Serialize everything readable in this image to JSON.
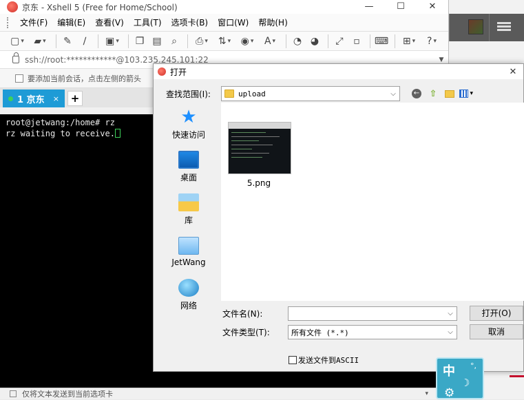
{
  "window": {
    "title": "京东 - Xshell 5 (Free for Home/School)",
    "controls": {
      "minimize": "—",
      "maximize": "☐",
      "close": "✕"
    }
  },
  "menu": [
    "文件(F)",
    "编辑(E)",
    "查看(V)",
    "工具(T)",
    "选项卡(B)",
    "窗口(W)",
    "帮助(H)"
  ],
  "address": {
    "value": "ssh://root:************@103.235.245.101:22"
  },
  "hint": {
    "text": "要添加当前会话，点击左侧的箭头"
  },
  "tabs": [
    {
      "label": "1 京东",
      "close": "×",
      "active": true
    }
  ],
  "tab_add": "+",
  "terminal": {
    "lines": [
      "root@jetwang:/home# rz",
      "rz waiting to receive."
    ]
  },
  "sendbar": {
    "text": "仅将文本发送到当前选项卡"
  },
  "dialog": {
    "title": "打开",
    "close": "✕",
    "look_in_label": "查找范围(I):",
    "look_in_value": "upload",
    "places": [
      {
        "label": "快速访问",
        "icon": "star-icon"
      },
      {
        "label": "桌面",
        "icon": "desktop-icon"
      },
      {
        "label": "库",
        "icon": "library-icon"
      },
      {
        "label": "JetWang",
        "icon": "computer-icon"
      },
      {
        "label": "网络",
        "icon": "network-icon"
      }
    ],
    "files": [
      {
        "name": "5.png"
      }
    ],
    "filename_label": "文件名(N):",
    "filename_value": "",
    "filetype_label": "文件类型(T):",
    "filetype_value": "所有文件 (*.*)",
    "open_button": "打开(O)",
    "cancel_button": "取消",
    "ascii_label": "发送文件到ASCII",
    "ascii_checked": false
  },
  "ime": {
    "lang": "中",
    "moon": "☽",
    "deg": "°,",
    "gear": "⚙"
  },
  "colors": {
    "tab_active": "#1e9bd6",
    "terminal_bg": "#000000",
    "cursor": "#3ed15a",
    "ime_bg": "#3aa8c6"
  }
}
